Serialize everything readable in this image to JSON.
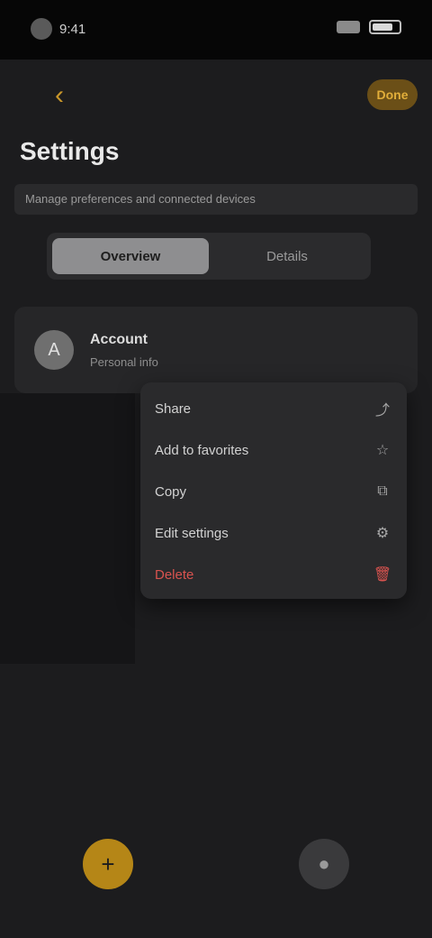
{
  "status_bar": {
    "time": "9:41"
  },
  "top_nav": {
    "back_icon": "chevron-left-icon",
    "action_label": "Done"
  },
  "header": {
    "title": "Settings",
    "subtitle": "Manage preferences and connected devices"
  },
  "segmented": {
    "tabs": [
      {
        "label": "Overview",
        "active": true
      },
      {
        "label": "Details",
        "active": false
      }
    ]
  },
  "card": {
    "avatar_initial": "A",
    "title": "Account",
    "subtitle": "Personal info"
  },
  "menu": {
    "items": [
      {
        "label": "Share",
        "icon": "share-icon",
        "glyph": "⤴",
        "danger": false
      },
      {
        "label": "Add to favorites",
        "icon": "star-icon",
        "glyph": "☆",
        "danger": false
      },
      {
        "label": "Copy",
        "icon": "copy-icon",
        "glyph": "⧉",
        "danger": false
      },
      {
        "label": "Edit settings",
        "icon": "gear-icon",
        "glyph": "⚙",
        "danger": false
      },
      {
        "label": "Delete",
        "icon": "trash-icon",
        "glyph": "🗑",
        "danger": true
      }
    ]
  },
  "bottom_nav": {
    "primary_icon": "plus-icon",
    "primary_glyph": "+",
    "secondary_icon": "user-icon",
    "secondary_glyph": "●"
  },
  "colors": {
    "accent": "#c8962a",
    "background": "#1c1c1e",
    "danger": "#d9534f"
  }
}
